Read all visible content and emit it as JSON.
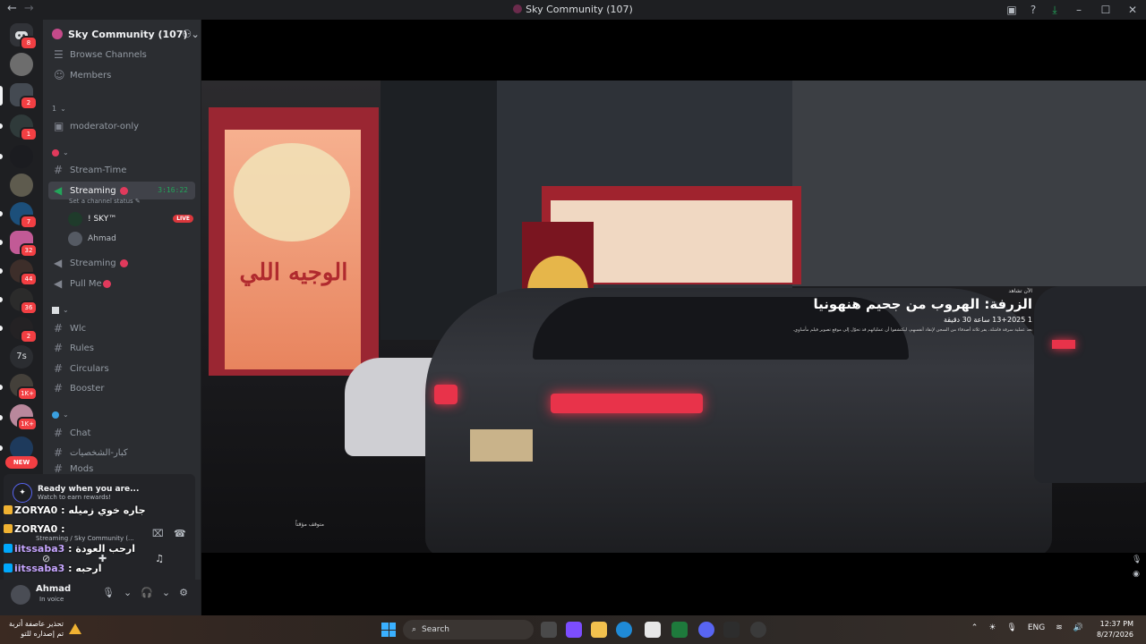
{
  "window": {
    "title": "Sky Community (107)"
  },
  "server": {
    "name": "Sky Community (107)"
  },
  "sidebar": {
    "browse_channels": "Browse Channels",
    "members": "Members",
    "cat1": "1",
    "moderator_only": "moderator-only",
    "stream_time": "Stream-Time",
    "streaming_active": "Streaming",
    "streaming_timer": "3:16:22",
    "set_status": "Set a channel status",
    "voice_users": [
      {
        "name": "! SKY™",
        "live": "LIVE"
      },
      {
        "name": "Ahmad"
      }
    ],
    "streaming2": "Streaming",
    "pull_me": "Pull Me",
    "wlc": "Wlc",
    "rules": "Rules",
    "circulars": "Circulars",
    "booster": "Booster",
    "chat": "Chat",
    "characters": "كبار-الشخصيات",
    "mods": "Mods"
  },
  "guilds": {
    "badges": [
      "8",
      "2",
      "1",
      "7",
      "32",
      "44",
      "36",
      "2",
      "1K+",
      "1K+"
    ],
    "text_guild": "7s",
    "new_label": "NEW"
  },
  "promo": {
    "title": "Ready when you are...",
    "subtitle": "Watch to earn rewards!"
  },
  "chat_overlay": [
    {
      "user": "ZORYA0",
      "text": "جاره خوي زميله"
    },
    {
      "user": "ZORYA0",
      "text": ""
    },
    {
      "user": "iitssaba3",
      "text": "ارحب العودة"
    },
    {
      "user": "iitssaba3",
      "text": "ارحبه"
    }
  ],
  "stream_info": "Streaming / Sky Community (...",
  "user": {
    "name": "Ahmad",
    "status": "In voice"
  },
  "video": {
    "small": "الآن تشاهد",
    "title": "الزرفة: الهروب من جحيم هنهونيا",
    "meta": "1    13+2025 ساعة 30 دقيقة",
    "desc": "بعد عملية سرقة فاشلة، يفر ثلاثة أصدقاء من السجن لإنقاذ أنفسهم، ليكتشفوا أن عملياتهم قد تحوّل إلى موقع تصوير فيلم مأساوي.",
    "paused": "متوقف مؤقتاً",
    "sign_text": "الوجيه اللي"
  },
  "taskbar": {
    "warn_title": "تحذير عاصفة أتربة",
    "warn_sub": "تم إصداره للتو",
    "search": "Search",
    "lang": "ENG",
    "time": "12:37 PM",
    "date": "8/27/2026"
  },
  "colors": {
    "accent": "#5865f2",
    "danger": "#f23f43",
    "success": "#23a55a",
    "live": "#da373c"
  }
}
